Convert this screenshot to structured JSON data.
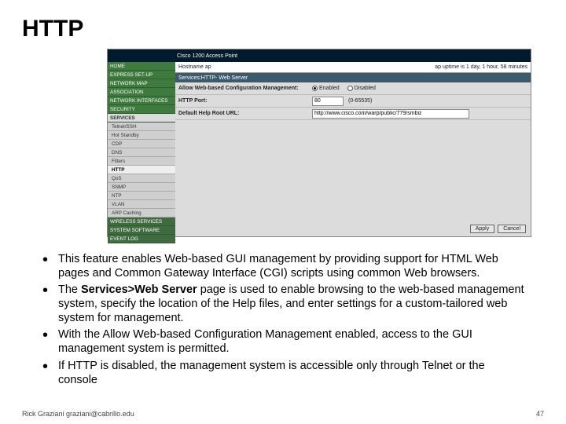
{
  "title": "HTTP",
  "screenshot": {
    "device_label": "Cisco 1200 Access Point",
    "hostname_label": "Hostname  ap",
    "uptime": "ap uptime is 1 day, 1 hour, 58 minutes",
    "breadcrumb": "Services:HTTP- Web Server",
    "sidebar": [
      "HOME",
      "EXPRESS SET-UP",
      "NETWORK MAP",
      "ASSOCIATION",
      "NETWORK INTERFACES",
      "SECURITY",
      "SERVICES",
      "Telnet/SSH",
      "Hot Standby",
      "CDP",
      "DNS",
      "Filters",
      "HTTP",
      "QoS",
      "SNMP",
      "NTP",
      "VLAN",
      "ARP Caching",
      "WIRELESS SERVICES",
      "SYSTEM SOFTWARE",
      "EVENT LOG"
    ],
    "row_allow_label": "Allow Web-based Configuration Management:",
    "row_allow_opt1": "Enabled",
    "row_allow_opt2": "Disabled",
    "row_port_label": "HTTP Port:",
    "row_port_value": "80",
    "row_port_hint": "(0-65535)",
    "row_url_label": "Default Help Root URL:",
    "row_url_value": "http://www.cisco.com/warp/public/779/smbiz",
    "apply": "Apply",
    "cancel": "Cancel"
  },
  "bullets": [
    {
      "pre": "This feature enables Web-based GUI management by providing support for HTML Web pages and Common Gateway Interface (CGI) scripts using common Web browsers.",
      "bold": "",
      "post": ""
    },
    {
      "pre": "The ",
      "bold": "Services>Web Server",
      "post": " page is used to enable browsing to the web-based management system, specify the location of the Help files, and enter settings for a custom-tailored web system for management."
    },
    {
      "pre": "With the Allow Web-based Configuration Management enabled, access to the GUI management system is permitted.",
      "bold": "",
      "post": ""
    },
    {
      "pre": "If HTTP is disabled, the management system is accessible only through Telnet or the console",
      "bold": "",
      "post": ""
    }
  ],
  "footer_left": "Rick Graziani  graziani@cabrillo.edu",
  "footer_right": "47"
}
